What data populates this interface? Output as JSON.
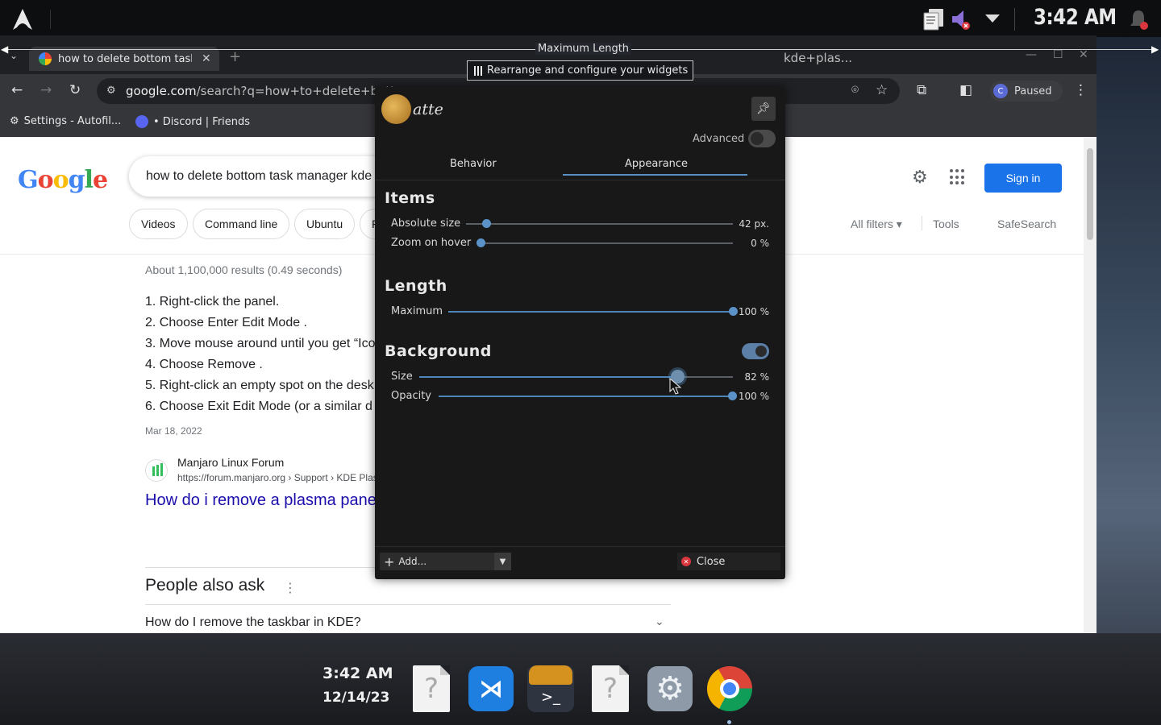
{
  "top_panel": {
    "clock": "3:42 AM",
    "icons": [
      "arch-linux-logo",
      "clipboard-icon",
      "volume-muted-icon",
      "expand-tray-icon",
      "notifications-icon"
    ]
  },
  "edit_mode": {
    "max_length_label": "Maximum Length",
    "rearrange_label": "Rearrange and configure your widgets"
  },
  "browser": {
    "tab_title": "how to delete bottom task",
    "url_host": "google.com",
    "url_path": "/search?q=how+to+delete+bottom",
    "url_tail": "kde+plas...",
    "profile_initial": "C",
    "profile_status": "Paused",
    "bookmarks": [
      "Settings - Autofil...",
      "• Discord | Friends"
    ]
  },
  "google": {
    "logo_text": "Google",
    "query": "how to delete bottom task manager kde",
    "sign_in": "Sign in",
    "chips": [
      "Videos",
      "Command line",
      "Ubuntu",
      "F"
    ],
    "tools": [
      "All filters",
      "Tools",
      "SafeSearch"
    ],
    "results_meta": "About 1,100,000 results (0.49 seconds)",
    "steps": [
      "1. Right-click the panel.",
      "2. Choose Enter Edit Mode .",
      "3. Move mouse around until you get “Ico",
      "4. Choose Remove .",
      "5. Right-click an empty spot on the desk",
      "6. Choose Exit Edit Mode (or a similar d"
    ],
    "date": "Mar 18, 2022",
    "site_name": "Manjaro Linux Forum",
    "site_url": "https://forum.manjaro.org › Support › KDE Plas",
    "result_link": "How do i remove a plasma pane",
    "people_also_ask": "People also ask",
    "paa_question": "How do I remove the taskbar in KDE?"
  },
  "latte": {
    "logo_text": "atte",
    "advanced_label": "Advanced",
    "advanced_on": false,
    "tabs": [
      "Behavior",
      "Appearance"
    ],
    "active_tab": "Appearance",
    "sections": {
      "items": {
        "title": "Items",
        "absolute_size_label": "Absolute size",
        "absolute_size_value": "42 px.",
        "absolute_size_fraction": 0.08,
        "zoom_label": "Zoom on hover",
        "zoom_value": "0 %",
        "zoom_fraction": 0.0
      },
      "length": {
        "title": "Length",
        "maximum_label": "Maximum",
        "maximum_value": "100 %",
        "maximum_fraction": 1.0
      },
      "background": {
        "title": "Background",
        "enabled": true,
        "size_label": "Size",
        "size_value": "82 %",
        "size_fraction": 0.82,
        "opacity_label": "Opacity",
        "opacity_value": "100 %",
        "opacity_fraction": 1.0
      }
    },
    "add_label": "Add...",
    "close_label": "Close"
  },
  "dock": {
    "clock": "3:42 AM",
    "date": "12/14/23",
    "apps": [
      "unknown-file-icon",
      "vscode-icon",
      "terminal-icon",
      "unknown-file-icon",
      "system-settings-icon",
      "chrome-icon"
    ]
  },
  "colors": {
    "accent": "#5b93c9",
    "google_blue": "#1a73e8",
    "link": "#1a0dab"
  }
}
